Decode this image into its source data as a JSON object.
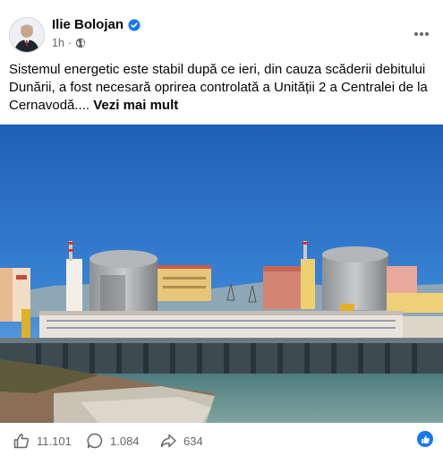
{
  "post": {
    "author": "Ilie Bolojan",
    "time": "1h",
    "dot": "·",
    "text": "Sistemul energetic este stabil după ce ieri, din cauza scăderii debitului Dunării, a fost necesară oprirea controlată a Unității 2 a Centralei de la Cernavodă.... ",
    "see_more": "Vezi mai mult"
  },
  "actions": {
    "likes": "11.101",
    "comments": "1.084",
    "shares": "634"
  },
  "icons": {
    "verified": "verified-badge-icon",
    "audience": "globe-icon",
    "more": "more-options-icon",
    "like": "thumbs-up-icon",
    "comment": "comment-icon",
    "share": "share-icon",
    "reaction": "like-reaction-icon"
  },
  "colors": {
    "brand": "#1877f2",
    "text": "#050505",
    "secondary": "#65676b"
  }
}
